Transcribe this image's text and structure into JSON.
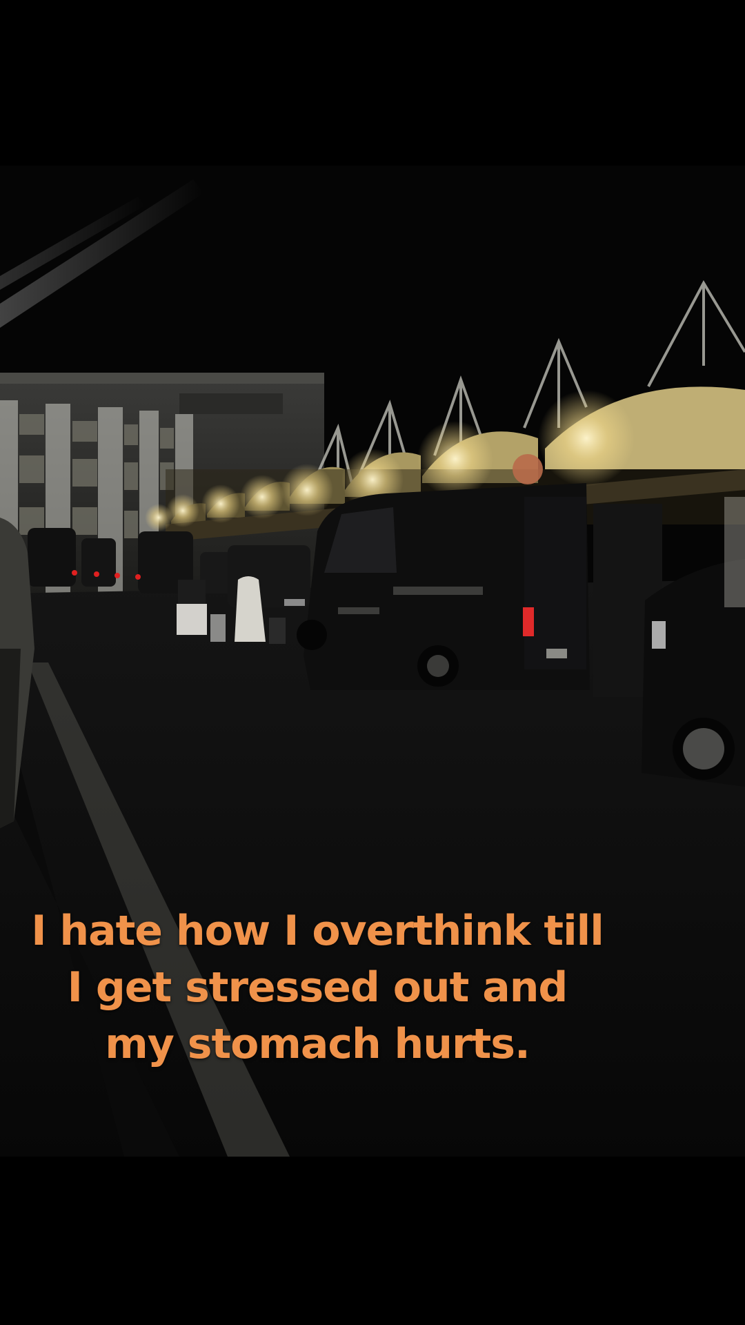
{
  "caption": {
    "text": "I hate how I overthink till I get stressed out and my stomach hurts.",
    "color": "#f0924a"
  },
  "scene": {
    "icon": "night-airport-curbside-photo",
    "background_color": "#000000",
    "canopy_light_color": "#f4e6b0",
    "taillight_color": "#e02020"
  }
}
